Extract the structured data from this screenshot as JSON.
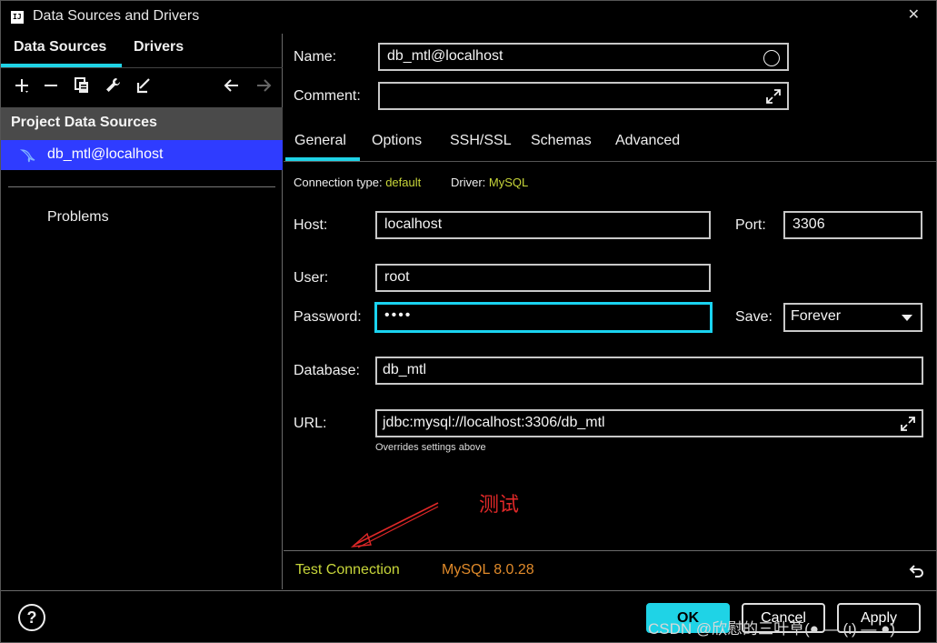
{
  "window": {
    "title": "Data Sources and Drivers",
    "app_icon_text": "IJ"
  },
  "left": {
    "tabs": [
      "Data Sources",
      "Drivers"
    ],
    "active_tab": "Data Sources",
    "toolbar_icons": [
      "add-icon",
      "remove-icon",
      "duplicate-icon",
      "settings-wrench-icon",
      "import-icon",
      "back-arrow-icon",
      "forward-arrow-icon"
    ],
    "section_header": "Project Data Sources",
    "data_source_item": "db_mtl@localhost",
    "problems_label": "Problems"
  },
  "form": {
    "name_label": "Name:",
    "name_value": "db_mtl@localhost",
    "comment_label": "Comment:",
    "comment_value": "",
    "tabs": [
      "General",
      "Options",
      "SSH/SSL",
      "Schemas",
      "Advanced"
    ],
    "active_tab": "General",
    "connection_type_label": "Connection type:",
    "connection_type_value": "default",
    "driver_label": "Driver:",
    "driver_value": "MySQL",
    "host_label": "Host:",
    "host_value": "localhost",
    "port_label": "Port:",
    "port_value": "3306",
    "user_label": "User:",
    "user_value": "root",
    "password_label": "Password:",
    "password_value": "••••",
    "save_label": "Save:",
    "save_value": "Forever",
    "database_label": "Database:",
    "database_value": "db_mtl",
    "url_label": "URL:",
    "url_value": "jdbc:mysql://localhost:3306/db_mtl",
    "url_note": "Overrides settings above"
  },
  "annotation": {
    "text": "测试"
  },
  "status": {
    "test_connection": "Test Connection",
    "mysql_version": "MySQL 8.0.28"
  },
  "footer": {
    "help": "?",
    "ok": "OK",
    "cancel": "Cancel",
    "apply": "Apply",
    "watermark": "CSDN @欣慰的三叶草(● — (ι) — ●)"
  },
  "colors": {
    "accent": "#1fd3e6",
    "selection": "#2f3cff",
    "yellow_green": "#c8d63a",
    "orange": "#e08a2a",
    "annotation_red": "#e02828"
  }
}
